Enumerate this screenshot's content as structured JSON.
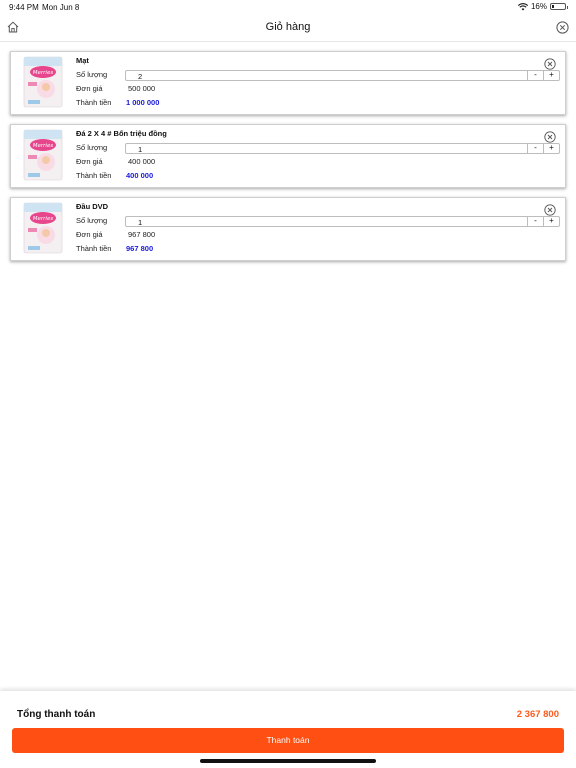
{
  "status_bar": {
    "time": "9:44 PM",
    "date": "Mon Jun 8",
    "battery_text": "16%",
    "battery_level": 0.16
  },
  "header": {
    "title": "Giỏ hàng",
    "home_icon": "home-icon",
    "close_icon": "close-circle-icon"
  },
  "labels": {
    "quantity": "Số lượng",
    "unit_price": "Đơn giá",
    "subtotal": "Thành tiền",
    "minus": "-",
    "plus": "+"
  },
  "cart_items": [
    {
      "name": "Mạt",
      "quantity": "2",
      "unit_price": "500 000",
      "subtotal": "1 000 000",
      "thumbnail_text": "Merries"
    },
    {
      "name": "Đá 2 X 4 # Bốn triệu đồng",
      "quantity": "1",
      "unit_price": "400 000",
      "subtotal": "400 000",
      "thumbnail_text": "Merries"
    },
    {
      "name": "Đầu DVD",
      "quantity": "1",
      "unit_price": "967 800",
      "subtotal": "967 800",
      "thumbnail_text": "Merries"
    }
  ],
  "footer": {
    "total_label": "Tổng thanh toán",
    "total_value": "2 367 800",
    "pay_button": "Thanh toán"
  },
  "colors": {
    "accent": "#ff4f12",
    "total_orange": "#ff5a1f",
    "subtotal_blue": "#1a1adb"
  }
}
